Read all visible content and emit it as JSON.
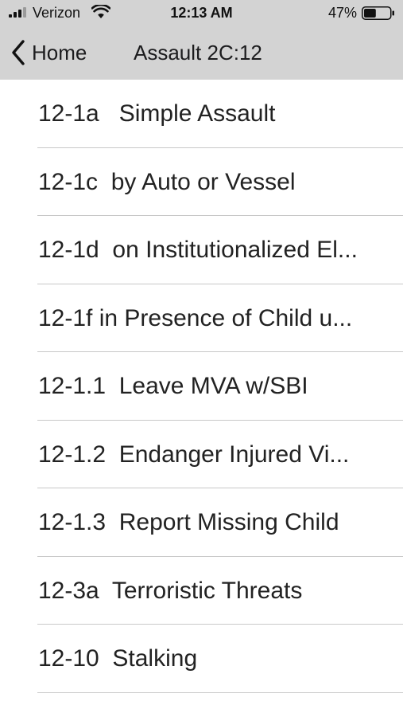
{
  "status_bar": {
    "carrier": "Verizon",
    "time": "12:13 AM",
    "battery_percent": "47%",
    "battery_level": 0.47
  },
  "nav": {
    "back_label": "Home",
    "title": "Assault 2C:12"
  },
  "items": [
    {
      "label": "12-1a   Simple Assault"
    },
    {
      "label": "12-1c  by Auto or Vessel"
    },
    {
      "label": "12-1d  on Institutionalized El..."
    },
    {
      "label": "12-1f in Presence of Child u..."
    },
    {
      "label": "12-1.1  Leave MVA w/SBI"
    },
    {
      "label": "12-1.2  Endanger Injured Vi..."
    },
    {
      "label": "12-1.3  Report Missing Child"
    },
    {
      "label": "12-3a  Terroristic Threats"
    },
    {
      "label": "12-10  Stalking"
    }
  ]
}
